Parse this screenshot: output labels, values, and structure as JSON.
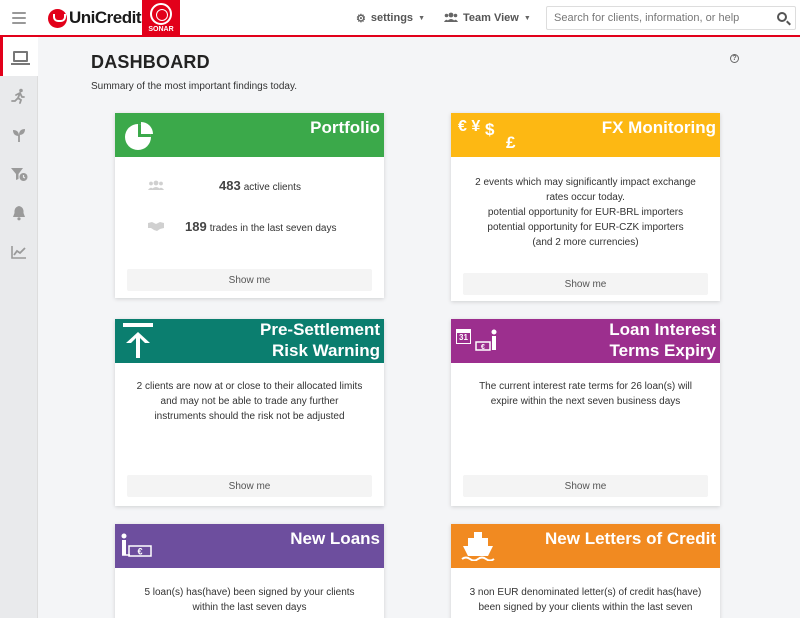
{
  "header": {
    "brand": "UniCredit",
    "app_badge": "SONAR",
    "settings_label": "settings",
    "team_label": "Team View",
    "search_placeholder": "Search for clients, information, or help"
  },
  "sidebar": {
    "items": [
      {
        "name": "dashboard",
        "icon": "monitor-icon",
        "active": true
      },
      {
        "name": "activity",
        "icon": "running-icon",
        "active": false
      },
      {
        "name": "growth",
        "icon": "sprout-icon",
        "active": false
      },
      {
        "name": "filters",
        "icon": "filter-icon",
        "active": false
      },
      {
        "name": "notifications",
        "icon": "bell-icon",
        "active": false
      },
      {
        "name": "analytics",
        "icon": "chart-icon",
        "active": false
      }
    ]
  },
  "page": {
    "title": "DASHBOARD",
    "subtitle": "Summary of the most important findings today."
  },
  "cards": {
    "portfolio": {
      "title": "Portfolio",
      "color": "#3ba94a",
      "stat1_value": "483",
      "stat1_label": "active clients",
      "stat2_value": "189",
      "stat2_label": "trades in the last seven days",
      "button": "Show me"
    },
    "fx": {
      "title": "FX Monitoring",
      "color": "#fdb813",
      "line1": "2 events which may significantly impact exchange",
      "line2": "rates occur today.",
      "line3": "potential opportunity for EUR-BRL importers",
      "line4": "potential opportunity for EUR-CZK importers",
      "line5": "(and 2 more currencies)",
      "button": "Show me"
    },
    "presettlement": {
      "title_line1": "Pre-Settlement",
      "title_line2": "Risk Warning",
      "color": "#0b7e6f",
      "line1": "2 clients are now at or close to their allocated limits",
      "line2": "and may not be able to trade any further",
      "line3": "instruments should the risk not be adjusted",
      "button": "Show me"
    },
    "loan_interest": {
      "title_line1": "Loan Interest",
      "title_line2": "Terms Expiry",
      "color": "#9c2f8e",
      "calendar_day": "31",
      "line1": "The current interest rate terms for 26 loan(s) will",
      "line2": "expire within the next seven business days",
      "button": "Show me"
    },
    "new_loans": {
      "title": "New Loans",
      "color": "#6d4e9e",
      "line1": "5 loan(s) has(have) been signed by your clients",
      "line2": "within the last seven days"
    },
    "letters_credit": {
      "title": "New Letters of Credit",
      "color": "#f18a21",
      "line1": "3 non EUR denominated letter(s) of credit has(have)",
      "line2": "been signed by your clients within the last seven"
    }
  }
}
